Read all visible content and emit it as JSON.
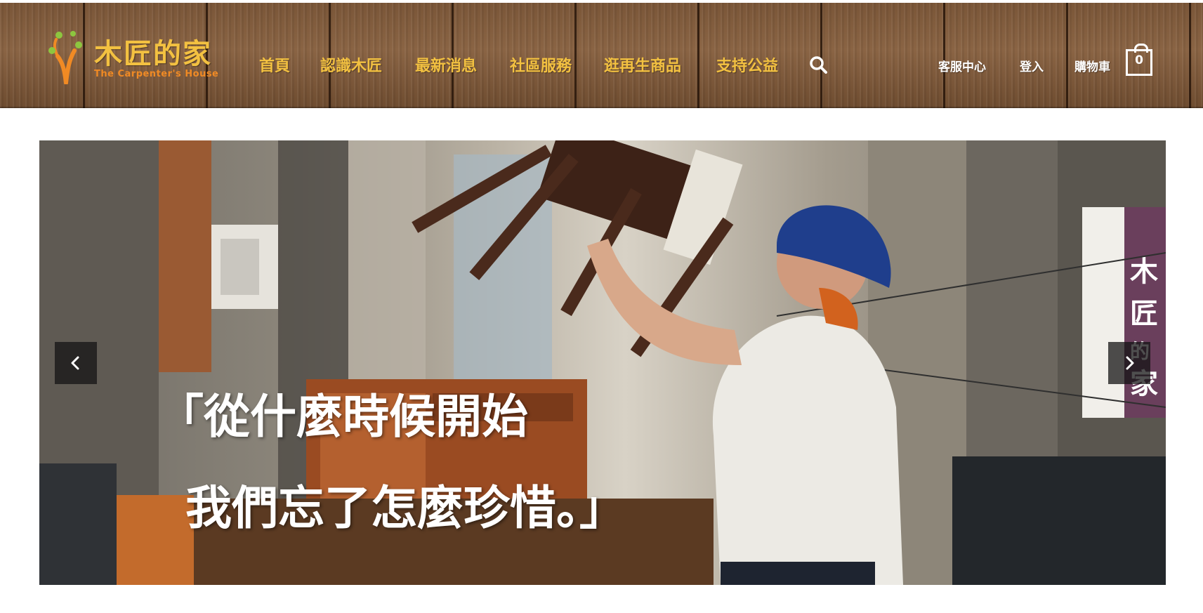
{
  "header": {
    "logo": {
      "name": "木匠的家",
      "subtitle": "The Carpenter's House",
      "colors": {
        "name": "#f3c141",
        "subtitle": "#f08a24",
        "tree": "#f08a24",
        "leaf": "#8dc63f"
      }
    },
    "nav": [
      {
        "label": "首頁"
      },
      {
        "label": "認識木匠"
      },
      {
        "label": "最新消息"
      },
      {
        "label": "社區服務"
      },
      {
        "label": "逛再生商品"
      },
      {
        "label": "支持公益"
      }
    ],
    "search_icon": "search-icon",
    "utility": {
      "customer_service": "客服中心",
      "login": "登入",
      "cart_label": "購物車",
      "cart_count": "0"
    },
    "colors": {
      "nav_text": "#f3c141",
      "utility_text": "#ffffff",
      "wood": "#7a5638"
    }
  },
  "hero": {
    "quote_line1": "「從什麼時候開始",
    "quote_line2": "我們忘了怎麼珍惜。」",
    "sign_text": "木匠的家",
    "prev_icon": "chevron-left-icon",
    "next_icon": "chevron-right-icon"
  }
}
